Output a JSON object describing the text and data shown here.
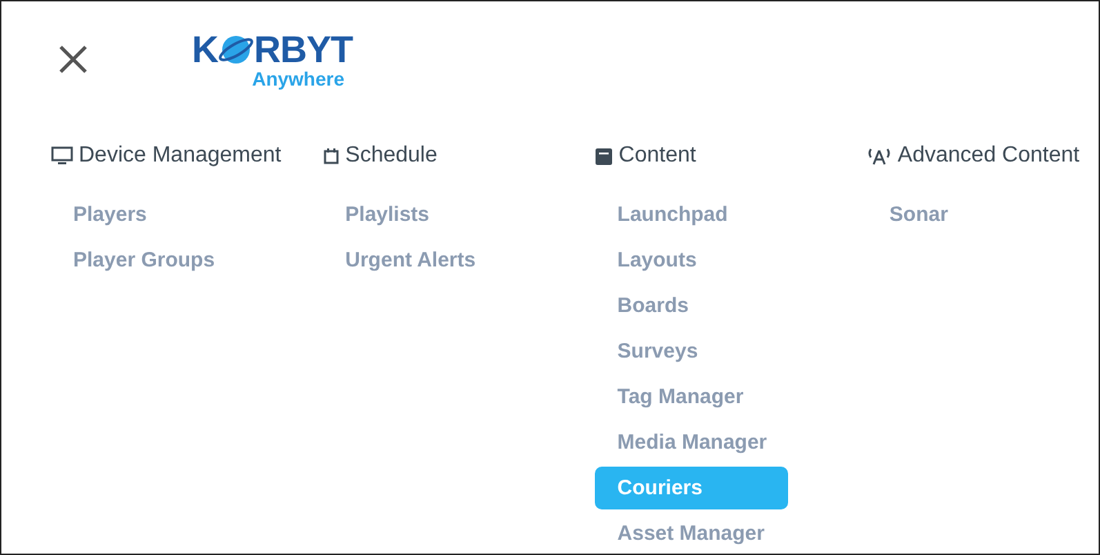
{
  "logo": {
    "before": "K",
    "after": "RBYT",
    "tagline": "Anywhere"
  },
  "sections": [
    {
      "kind": "device",
      "title": "Device Management",
      "items": [
        {
          "label": "Players",
          "selected": false
        },
        {
          "label": "Player Groups",
          "selected": false
        }
      ]
    },
    {
      "kind": "schedule",
      "title": "Schedule",
      "items": [
        {
          "label": "Playlists",
          "selected": false
        },
        {
          "label": "Urgent Alerts",
          "selected": false
        }
      ]
    },
    {
      "kind": "content",
      "title": "Content",
      "items": [
        {
          "label": "Launchpad",
          "selected": false
        },
        {
          "label": "Layouts",
          "selected": false
        },
        {
          "label": "Boards",
          "selected": false
        },
        {
          "label": "Surveys",
          "selected": false
        },
        {
          "label": "Tag Manager",
          "selected": false
        },
        {
          "label": "Media Manager",
          "selected": false
        },
        {
          "label": "Couriers",
          "selected": true
        },
        {
          "label": "Asset Manager",
          "selected": false
        }
      ]
    },
    {
      "kind": "advanced",
      "title": "Advanced Content",
      "items": [
        {
          "label": "Sonar",
          "selected": false
        }
      ]
    }
  ]
}
